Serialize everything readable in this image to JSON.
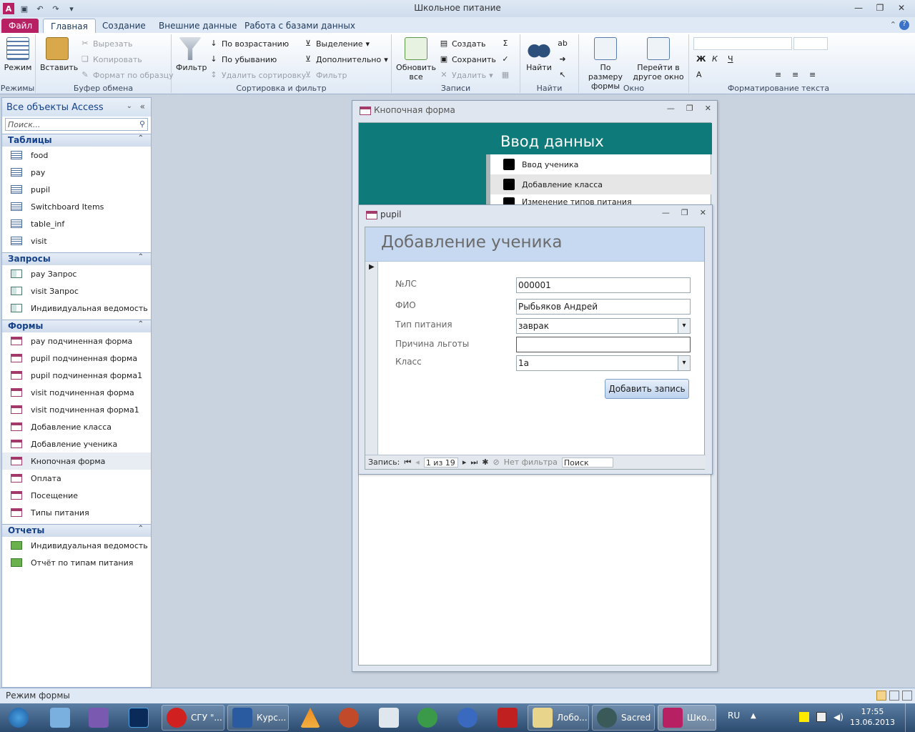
{
  "app": {
    "title": "Школьное питание"
  },
  "tabs": [
    "Файл",
    "Главная",
    "Создание",
    "Внешние данные",
    "Работа с базами данных"
  ],
  "ribbon": {
    "groups": {
      "modes": "Режимы",
      "clipboard": "Буфер обмена",
      "sort": "Сортировка и фильтр",
      "records": "Записи",
      "find": "Найти",
      "window": "Окно",
      "textformat": "Форматирование текста"
    },
    "mode": "Режим",
    "paste": "Вставить",
    "cut": "Вырезать",
    "copy": "Копировать",
    "formatpaint": "Формат по образцу",
    "filter": "Фильтр",
    "asc": "По возрастанию",
    "desc": "По убыванию",
    "removesort": "Удалить сортировку",
    "selection": "Выделение",
    "advanced": "Дополнительно",
    "togglefilter": "Фильтр",
    "refresh": "Обновить все",
    "create": "Создать",
    "save": "Сохранить",
    "delete": "Удалить",
    "sum": "Σ",
    "find": "Найти",
    "fitform": "По размеру формы",
    "switchwin": "Перейти в другое окно"
  },
  "nav": {
    "header": "Все объекты Access",
    "search_placeholder": "Поиск...",
    "tables_label": "Таблицы",
    "tables": [
      "food",
      "pay",
      "pupil",
      "Switchboard Items",
      "table_inf",
      "visit"
    ],
    "queries_label": "Запросы",
    "queries": [
      "pay Запрос",
      "visit Запрос",
      "Индивидуальная ведомость"
    ],
    "forms_label": "Формы",
    "forms": [
      "pay подчиненная форма",
      "pupil подчиненная форма",
      "pupil подчиненная форма1",
      "visit подчиненная форма",
      "visit подчиненная форма1",
      "Добавление класса",
      "Добавление ученика",
      "Кнопочная форма",
      "Оплата",
      "Посещение",
      "Типы питания"
    ],
    "reports_label": "Отчеты",
    "reports": [
      "Индивидуальная ведомость",
      "Отчёт по типам питания"
    ]
  },
  "switchboard": {
    "title": "Кнопочная форма",
    "heading": "Ввод данных",
    "items": [
      "Ввод ученика",
      "Добавление класса",
      "Изменение типов питания"
    ]
  },
  "pupil": {
    "title": "pupil",
    "heading": "Добавление ученика",
    "fields": {
      "ls_label": "№ЛС",
      "ls_value": "000001",
      "fio_label": "ФИО",
      "fio_value": "Рыбьяков Андрей",
      "type_label": "Тип питания",
      "type_value": "заврак",
      "reason_label": "Причина льготы",
      "reason_value": "",
      "class_label": "Класс",
      "class_value": "1а"
    },
    "add_button": "Добавить запись",
    "recnav": {
      "label": "Запись:",
      "position": "1 из 19",
      "filter": "Нет фильтра",
      "search": "Поиск"
    }
  },
  "status": "Режим формы",
  "taskbar": {
    "items": [
      "СГУ \"...",
      "Курс...",
      "Лобо...",
      "Sacred",
      "Шко..."
    ],
    "lang": "RU",
    "time": "17:55",
    "date": "13.06.2013"
  }
}
